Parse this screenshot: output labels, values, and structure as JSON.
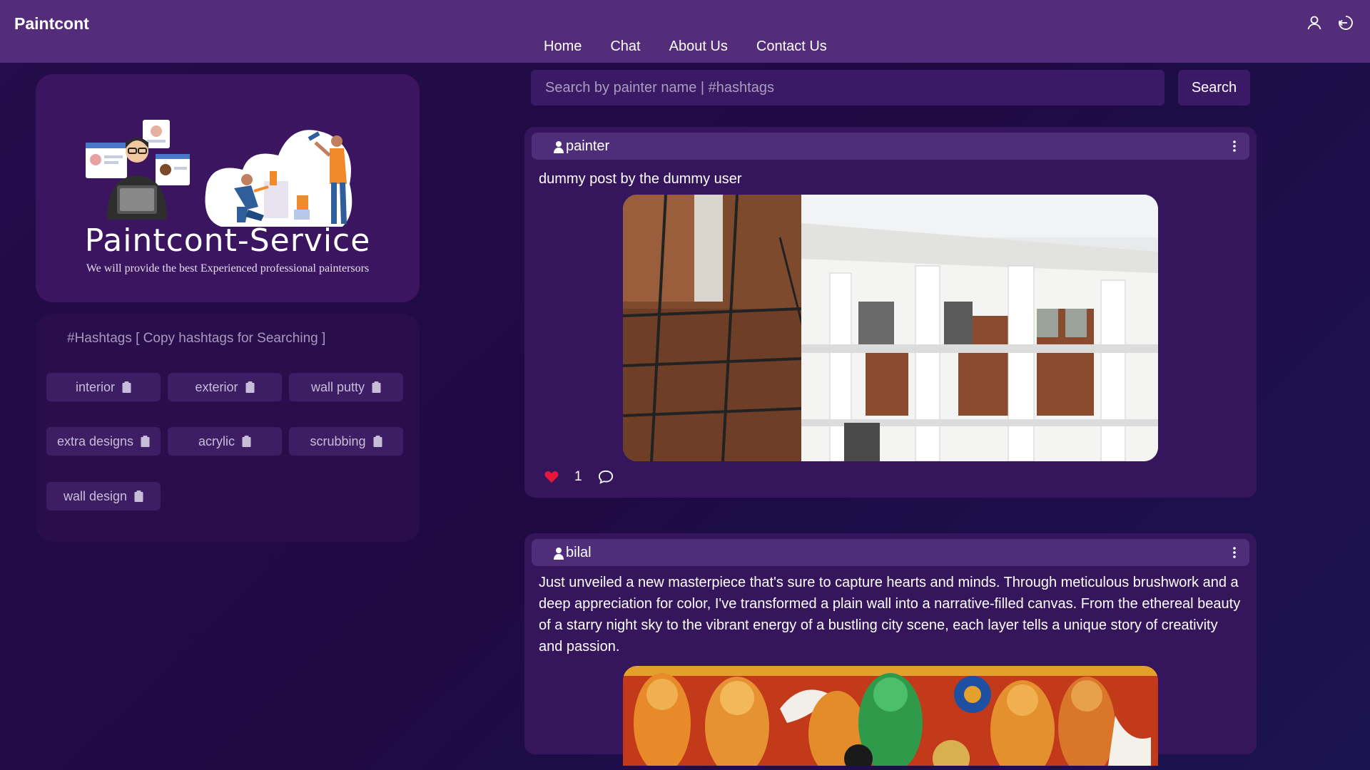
{
  "brand": "Paintcont",
  "nav": [
    "Home",
    "Chat",
    "About Us",
    "Contact Us"
  ],
  "top_icons": [
    "user-icon",
    "logout-icon"
  ],
  "hero": {
    "title": "Paintcont-Service",
    "subtitle": "We will provide the best Experienced professional paintersors"
  },
  "hashtags": {
    "title": "#Hashtags [ Copy hashtags for Searching ]",
    "items": [
      "interior",
      "exterior",
      "wall putty",
      "extra designs",
      "acrylic",
      "scrubbing",
      "wall design"
    ]
  },
  "search": {
    "placeholder": "Search by painter name | #hashtags",
    "button": "Search"
  },
  "posts": [
    {
      "user": "painter",
      "text": "dummy post by the dummy user",
      "likes": "1"
    },
    {
      "user": "bilal",
      "text": "Just unveiled a new masterpiece that's sure to capture hearts and minds. Through meticulous brushwork and a deep appreciation for color, I've transformed a plain wall into a narrative-filled canvas. From the ethereal beauty of a starry night sky to the vibrant energy of a bustling city scene, each layer tells a unique story of creativity and passion."
    }
  ],
  "colors": {
    "topbar": "#532c7a",
    "card": "#35155c",
    "like": "#e8173a"
  }
}
